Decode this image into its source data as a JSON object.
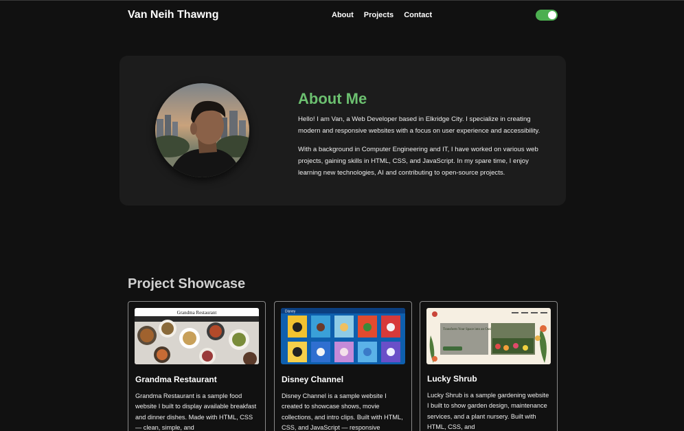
{
  "header": {
    "brand": "Van Neih Thawng",
    "nav": [
      "About",
      "Projects",
      "Contact"
    ],
    "theme_toggle_on": true
  },
  "about": {
    "title": "About Me",
    "paragraphs": [
      "Hello! I am Van, a Web Developer based in Elkridge City. I specialize in creating modern and responsive websites with a focus on user experience and accessibility.",
      "With a background in Computer Engineering and IT, I have worked on various web projects, gaining skills in HTML, CSS, and JavaScript. In my spare time, I enjoy learning new technologies, AI and contributing to open-source projects."
    ]
  },
  "projects": {
    "title": "Project Showcase",
    "items": [
      {
        "name": "Grandma Restaurant",
        "thumb_title": "Grandma Restaurant",
        "description": "Grandma Restaurant is a sample food website I built to display available breakfast and dinner dishes. Made with HTML, CSS — clean, simple, and"
      },
      {
        "name": "Disney Channel",
        "thumb_title": "Disney",
        "description": "Disney Channel is a sample website I created to showcase shows, movie collections, and intro clips. Built with HTML, CSS, and JavaScript — responsive"
      },
      {
        "name": "Lucky Shrub",
        "thumb_title": "Transform Your Space into an Oasis",
        "description": "Lucky Shrub is a sample gardening website I built to show garden design, maintenance services, and a plant nursery. Built with HTML, CSS, and"
      }
    ]
  },
  "colors": {
    "background": "#111111",
    "card": "#1c1c1c",
    "accent_green": "#6cc070",
    "toggle_green": "#4caf50"
  }
}
